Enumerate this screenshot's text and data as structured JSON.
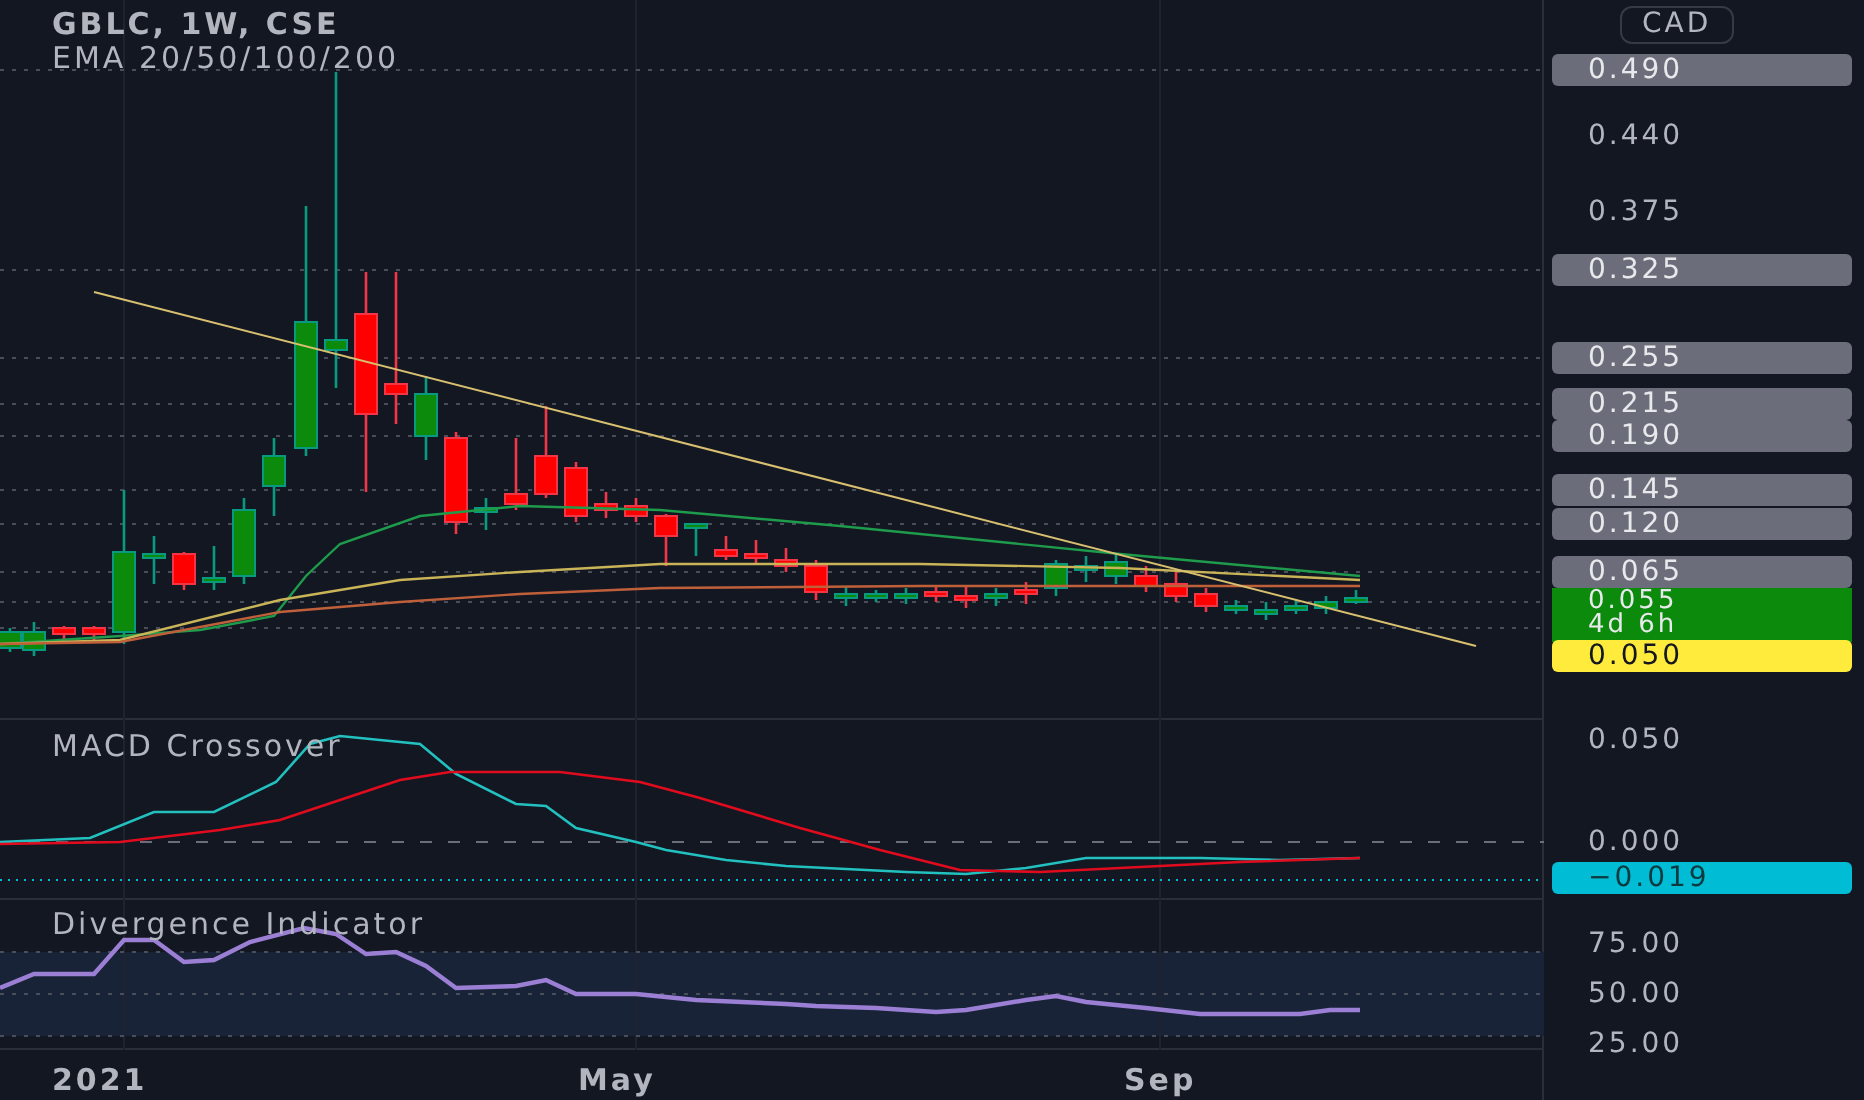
{
  "symbol": {
    "title": "GBLC, 1W, CSE",
    "indicator": "EMA 20/50/100/200"
  },
  "currency": "CAD",
  "price_axis": [
    {
      "text": "0.490",
      "kind": "tag"
    },
    {
      "text": "0.440",
      "kind": "tick"
    },
    {
      "text": "0.375",
      "kind": "tick"
    },
    {
      "text": "0.325",
      "kind": "tag"
    },
    {
      "text": "0.255",
      "kind": "tag"
    },
    {
      "text": "0.215",
      "kind": "tag"
    },
    {
      "text": "0.190",
      "kind": "tag"
    },
    {
      "text": "0.145",
      "kind": "tag"
    },
    {
      "text": "0.120",
      "kind": "tag"
    },
    {
      "text": "0.065",
      "kind": "tag"
    },
    {
      "text": "0.055",
      "kind": "last",
      "countdown": "4d 6h"
    },
    {
      "text": "0.050",
      "kind": "highlight"
    }
  ],
  "panes": [
    {
      "title": "MACD Crossover",
      "axis": [
        {
          "text": "0.050",
          "kind": "tick"
        },
        {
          "text": "0.000",
          "kind": "tick"
        },
        {
          "text": "−0.019",
          "kind": "value"
        }
      ]
    },
    {
      "title": "Divergence Indicator",
      "axis": [
        {
          "text": "75.00",
          "kind": "tick"
        },
        {
          "text": "50.00",
          "kind": "tick"
        },
        {
          "text": "25.00",
          "kind": "tick"
        }
      ]
    }
  ],
  "time_axis": [
    "2021",
    "May",
    "Sep"
  ]
}
